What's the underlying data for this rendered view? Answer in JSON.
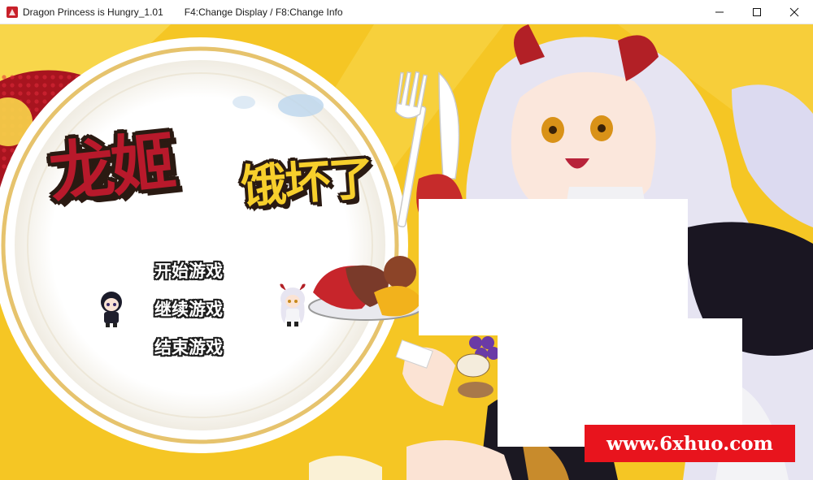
{
  "window": {
    "title": "Dragon Princess is Hungry_1.01",
    "hint": "F4:Change Display / F8:Change Info",
    "icon": "app-icon",
    "controls": [
      "minimize-icon",
      "maximize-icon",
      "close-icon"
    ]
  },
  "game": {
    "logo": {
      "main": "龙姬",
      "sub": "饿坏了"
    },
    "menu": [
      {
        "label": "开始游戏"
      },
      {
        "label": "继续游戏"
      },
      {
        "label": "结束游戏"
      }
    ],
    "colors": {
      "background_yellow": "#f5c624",
      "logo_red": "#b8192b",
      "logo_yellow": "#f7cf2c",
      "plate_ring": "#e8c36a"
    }
  },
  "watermark": {
    "text": "www.6xhuo.com",
    "color": "#e8141d"
  }
}
